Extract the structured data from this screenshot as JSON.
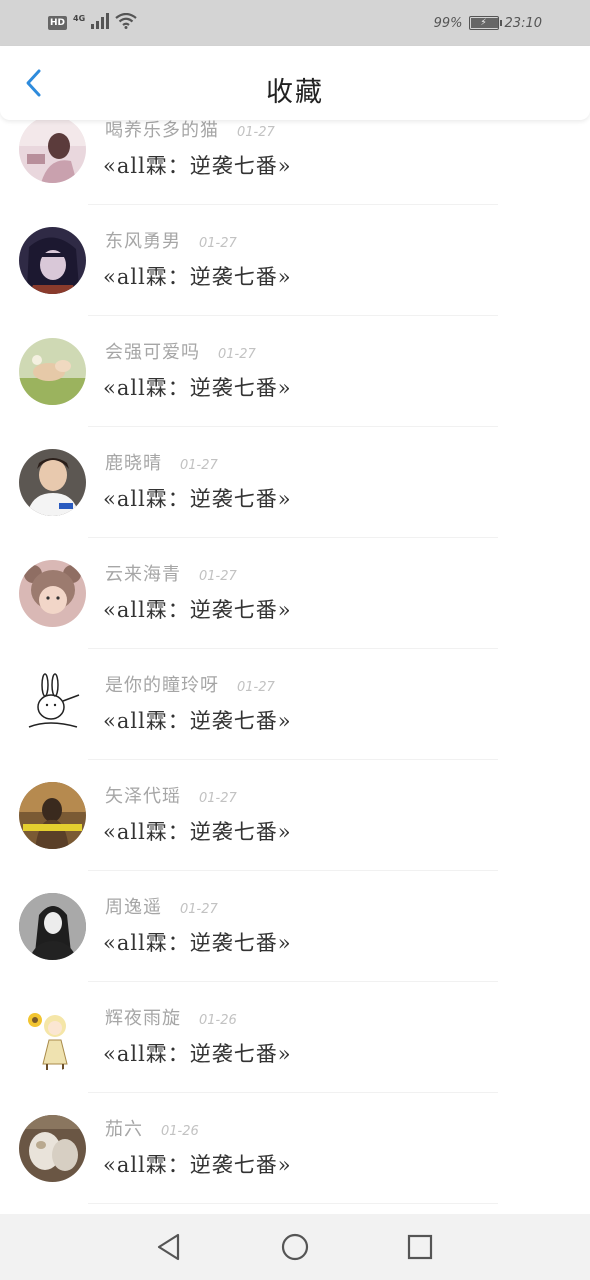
{
  "status_bar": {
    "hd": "HD",
    "network": "4G",
    "battery_pct": "99%",
    "battery_level": 0.99,
    "time": "23:10"
  },
  "header": {
    "title": "收藏",
    "back_icon": "chevron-left-icon"
  },
  "colors": {
    "accent": "#2e8bdc",
    "status_bar_bg": "#d4d4d4",
    "nav_bar_bg": "#f2f2f2"
  },
  "favorites": [
    {
      "user": "喝养乐多的猫",
      "date": "01-27",
      "title": "«all霖：逆袭七番»"
    },
    {
      "user": "东风勇男",
      "date": "01-27",
      "title": "«all霖：逆袭七番»"
    },
    {
      "user": "会强可爱吗",
      "date": "01-27",
      "title": "«all霖：逆袭七番»"
    },
    {
      "user": "鹿晓晴",
      "date": "01-27",
      "title": "«all霖：逆袭七番»"
    },
    {
      "user": "云来海青",
      "date": "01-27",
      "title": "«all霖：逆袭七番»"
    },
    {
      "user": "是你的瞳玲呀",
      "date": "01-27",
      "title": "«all霖：逆袭七番»"
    },
    {
      "user": "矢泽代瑶",
      "date": "01-27",
      "title": "«all霖：逆袭七番»"
    },
    {
      "user": "周逸遥",
      "date": "01-27",
      "title": "«all霖：逆袭七番»"
    },
    {
      "user": "辉夜雨旋",
      "date": "01-26",
      "title": "«all霖：逆袭七番»"
    },
    {
      "user": "茄六",
      "date": "01-26",
      "title": "«all霖：逆袭七番»"
    }
  ],
  "nav": {
    "back": "triangle-back-icon",
    "home": "circle-home-icon",
    "recent": "square-recent-icon"
  }
}
